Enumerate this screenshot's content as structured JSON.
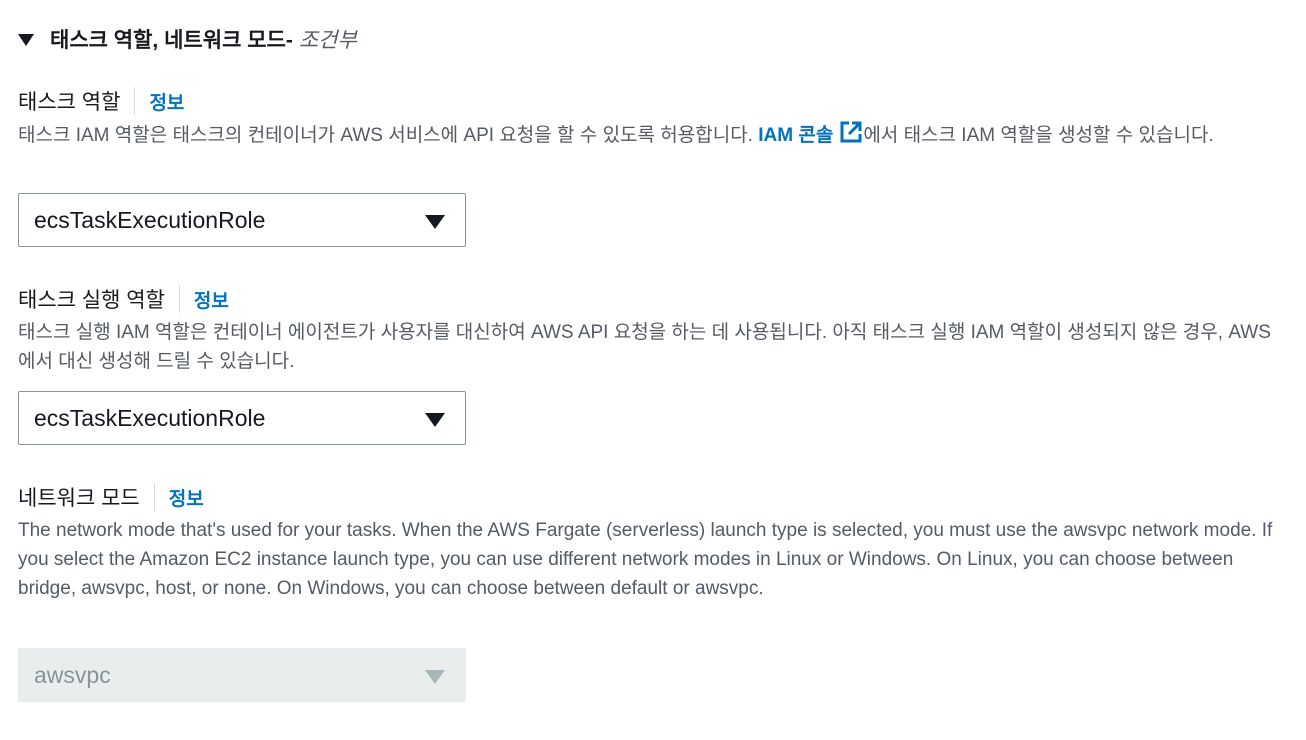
{
  "section": {
    "title": "태스크 역할, 네트워크 모드-",
    "optional": "조건부"
  },
  "task_role": {
    "label": "태스크 역할",
    "info": "정보",
    "desc_before": "태스크 IAM 역할은 태스크의 컨테이너가 AWS 서비스에 API 요청을 할 수 있도록 허용합니다. ",
    "desc_link": "IAM 콘솔",
    "desc_after": "에서 태스크 IAM 역할을 생성할 수 있습니다.",
    "selected": "ecsTaskExecutionRole"
  },
  "execution_role": {
    "label": "태스크 실행 역할",
    "info": "정보",
    "desc": "태스크 실행 IAM 역할은 컨테이너 에이전트가 사용자를 대신하여 AWS API 요청을 하는 데 사용됩니다. 아직 태스크 실행 IAM 역할이 생성되지 않은 경우, AWS에서 대신 생성해 드릴 수 있습니다.",
    "selected": "ecsTaskExecutionRole"
  },
  "network_mode": {
    "label": "네트워크 모드",
    "info": "정보",
    "desc": "The network mode that's used for your tasks. When the AWS Fargate (serverless) launch type is selected, you must use the awsvpc network mode. If you select the Amazon EC2 instance launch type, you can use different network modes in Linux or Windows. On Linux, you can choose between bridge, awsvpc, host, or none. On Windows, you can choose between default or awsvpc.",
    "selected": "awsvpc",
    "disabled": true
  },
  "colors": {
    "link": "#0073bb",
    "text": "#16191f",
    "secondary": "#545b64",
    "border": "#879596",
    "disabled_bg": "#eaeded"
  },
  "icons": [
    "caret-down-icon",
    "external-link-icon",
    "dropdown-arrow-icon"
  ]
}
